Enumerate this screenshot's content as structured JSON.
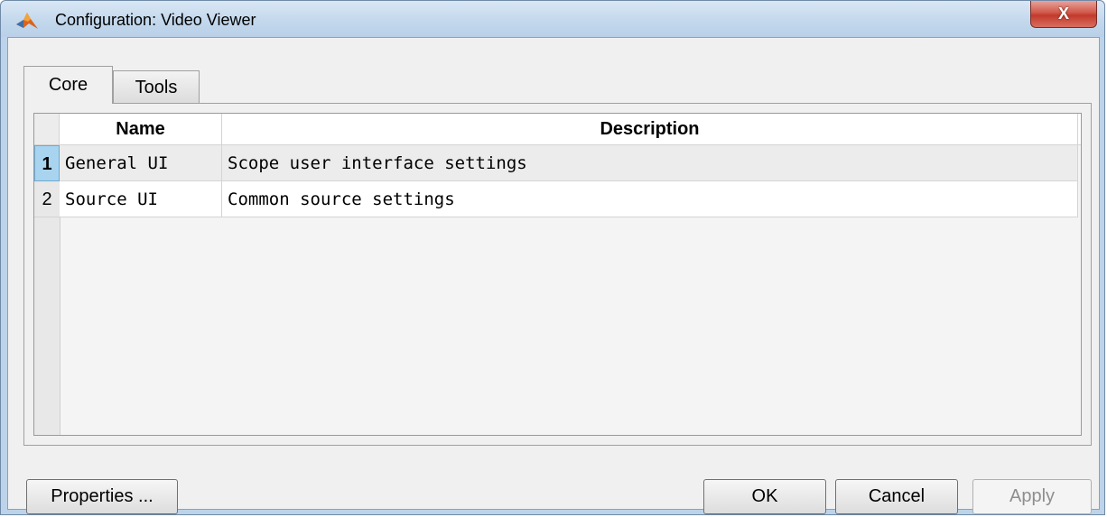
{
  "window": {
    "title": "Configuration: Video Viewer",
    "close_glyph": "X"
  },
  "tabs": [
    {
      "label": "Core",
      "selected": true
    },
    {
      "label": "Tools",
      "selected": false
    }
  ],
  "table": {
    "headers": {
      "name": "Name",
      "description": "Description"
    },
    "rows": [
      {
        "index": "1",
        "name": "General UI",
        "description": "Scope user interface settings",
        "selected": true
      },
      {
        "index": "2",
        "name": "Source UI",
        "description": "Common source settings",
        "selected": false
      }
    ]
  },
  "buttons": {
    "properties": "Properties ...",
    "ok": "OK",
    "cancel": "Cancel",
    "apply": "Apply"
  },
  "colors": {
    "titlebar": "#c2d7ec",
    "close": "#c23a2b",
    "selected_row_header": "#a8d4ef"
  }
}
